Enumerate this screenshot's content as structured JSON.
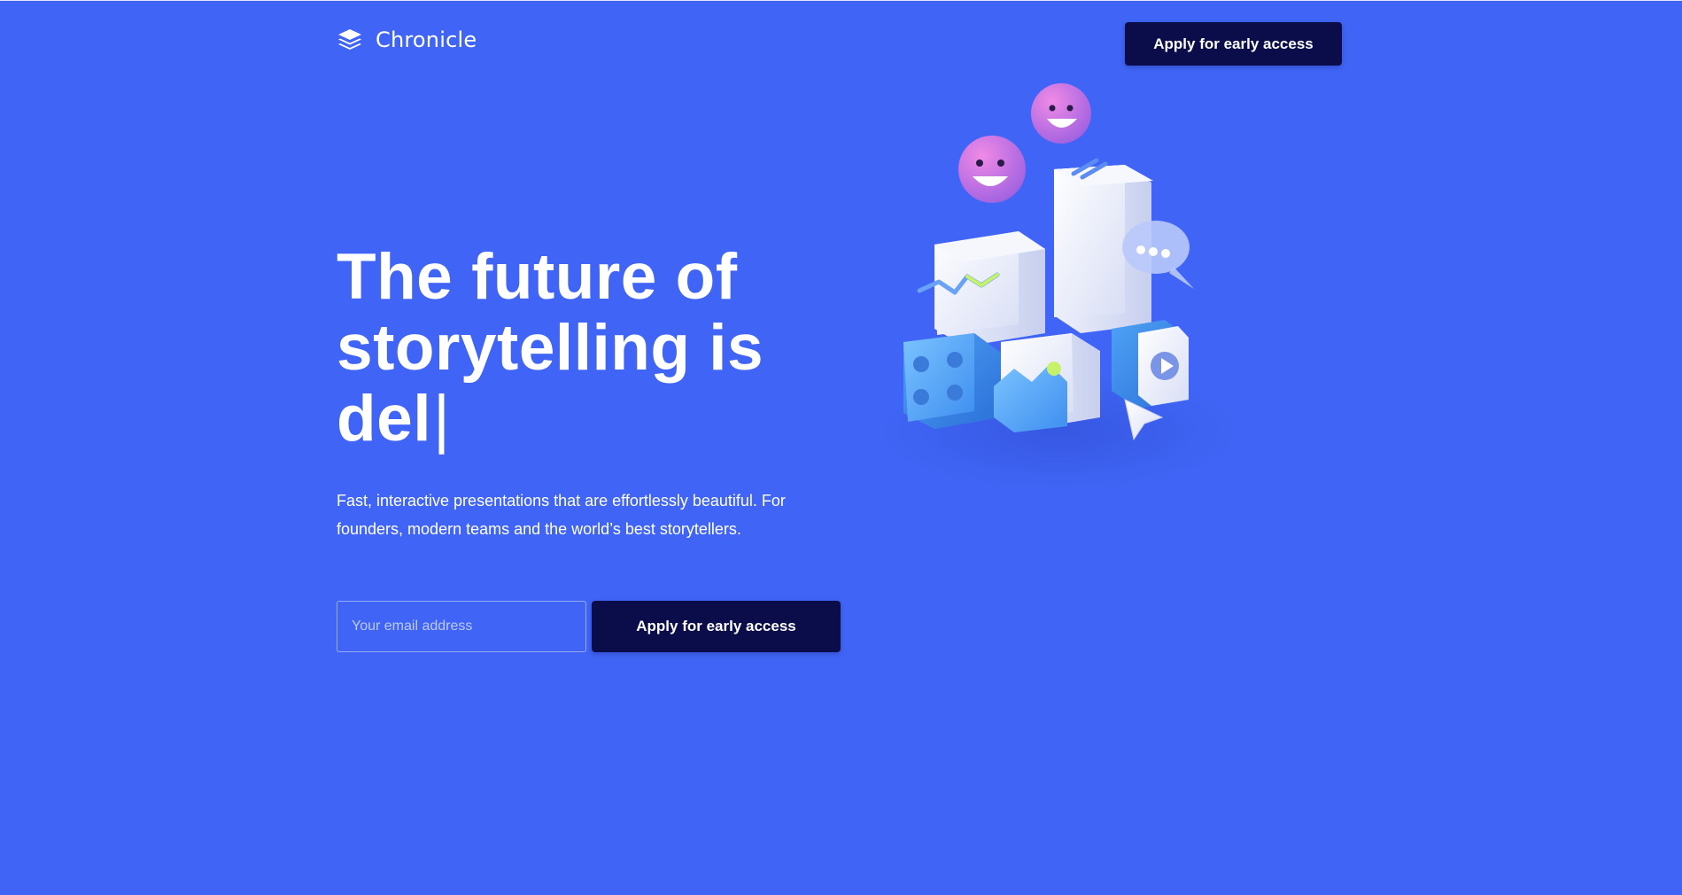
{
  "brand": {
    "name": "Chronicle",
    "logo_icon": "stacked-layers-icon"
  },
  "header": {
    "cta_label": "Apply for early access"
  },
  "hero": {
    "title_lines": [
      "The future of",
      "storytelling is",
      "del"
    ],
    "typing_cursor": "|",
    "subtitle": "Fast, interactive presentations that are effortlessly beautiful. For founders, modern teams and the world’s best storytellers."
  },
  "signup": {
    "email_placeholder": "Your email address",
    "email_value": "",
    "cta_label": "Apply for early access"
  },
  "illustration": {
    "icons": [
      "smiley-face-icon",
      "chat-bubble-icon",
      "image-icon",
      "play-button-icon",
      "cursor-arrow-icon",
      "line-chart-icon",
      "dots-grid-icon"
    ]
  },
  "colors": {
    "background": "#4065f6",
    "button": "#0b0d4b",
    "text": "#ffffff",
    "smiley": "#d36ad8",
    "accent_lime": "#c6f26a"
  }
}
